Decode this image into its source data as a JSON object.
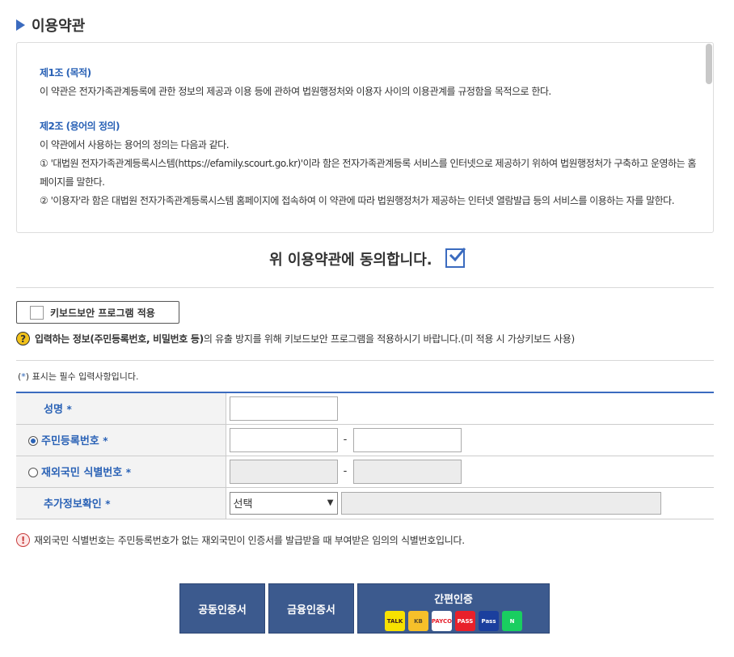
{
  "section": {
    "title": "이용약관"
  },
  "terms": {
    "art1_title": "제1조 (목적)",
    "art1_body": "이 약관은 전자가족관계등록에 관한 정보의 제공과 이용 등에 관하여 법원행정처와 이용자 사이의 이용관계를 규정함을 목적으로 한다.",
    "art2_title": "제2조 (용어의 정의)",
    "art2_body1": "이 약관에서 사용하는 용어의 정의는 다음과 같다.",
    "art2_item1": "① '대법원 전자가족관계등록시스템(https://efamily.scourt.go.kr)'이라 함은 전자가족관계등록 서비스를 인터넷으로 제공하기 위하여 법원행정처가 구축하고 운영하는 홈페이지를 말한다.",
    "art2_item2": "② '이용자'라 함은 대법원 전자가족관계등록시스템 홈페이지에 접속하여 이 약관에 따라 법원행정처가 제공하는 인터넷 열람발급 등의 서비스를 이용하는 자를 말한다."
  },
  "agree": {
    "label": "위 이용약관에 동의합니다.",
    "checked": true
  },
  "keyboard": {
    "button_label": "키보드보안 프로그램 적용",
    "notice_bold": "입력하는 정보(주민등록번호, 비밀번호 등)",
    "notice_rest": "의 유출 방지를 위해 키보드보안 프로그램을 적용하시기 바랍니다.(미 적용 시 가상키보드 사용)"
  },
  "required_note": {
    "prefix": "(",
    "star": "*",
    "suffix": ") 표시는 필수 입력사항입니다."
  },
  "form": {
    "name_label": "성명",
    "rrn_label": "주민등록번호",
    "foreign_label": "재외국민 식별번호",
    "extra_label": "추가정보확인",
    "star": "*",
    "dash": "-",
    "select_value": "선택",
    "rrn_selected": true
  },
  "notice2": "재외국민 식별번호는 주민등록번호가 없는 재외국민이 인증서를 발급받을 때 부여받은 임의의 식별번호입니다.",
  "buttons": {
    "public_cert": "공동인증서",
    "financial_cert": "금융인증서",
    "easy_cert": "간편인증",
    "providers": [
      {
        "name": "kakao-icon",
        "text": "TALK",
        "bg": "#f7e100",
        "fg": "#3a1d1d"
      },
      {
        "name": "kb-icon",
        "text": "KB",
        "bg": "#f6c02a",
        "fg": "#5a4a2a"
      },
      {
        "name": "payco-icon",
        "text": "PAYCO",
        "bg": "#ffffff",
        "fg": "#e61e2b"
      },
      {
        "name": "pass-red-icon",
        "text": "PASS",
        "bg": "#e8202a",
        "fg": "#ffffff"
      },
      {
        "name": "pass-blue-icon",
        "text": "Pass",
        "bg": "#1b3f9e",
        "fg": "#ffffff"
      },
      {
        "name": "naver-icon",
        "text": "N",
        "bg": "#19ce60",
        "fg": "#ffffff"
      }
    ]
  },
  "colors": {
    "accent": "#3b6bbf",
    "button": "#3c5a8e",
    "label_text": "#2a62b6"
  }
}
